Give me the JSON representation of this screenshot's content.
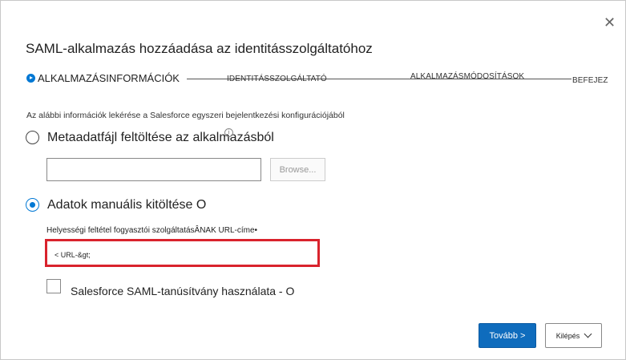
{
  "dialog": {
    "title": "SAML-alkalmazás hozzáadása az identitásszolgáltatóhoz",
    "close_glyph": "✕"
  },
  "steps": [
    {
      "label": "ALKALMAZÁSINFORMÁCIÓK",
      "active": true
    },
    {
      "label": "IDENTITÁSSZOLGÁLTATÓ",
      "active": false
    },
    {
      "label": "ALKALMAZÁSMÓDOSÍTÁSOK",
      "active": false
    },
    {
      "label": "BEFEJEZ",
      "active": false
    }
  ],
  "info_text": "Az alábbi információk lekérése a Salesforce egyszeri bejelentkezési konfigurációjából",
  "options": {
    "metadata": {
      "label": "Metaadatfájl feltöltése az alkalmazásból",
      "selected": false,
      "info_glyph": "i"
    },
    "manual": {
      "label": "Adatok manuális kitöltése O",
      "selected": true
    }
  },
  "file_upload": {
    "value": "",
    "browse_label": "Browse..."
  },
  "acs_field": {
    "label": "Helyességi feltétel fogyasztói szolgáltatásÂNAK URL-címe•",
    "value": "< URL-&gt;"
  },
  "certificate_checkbox": {
    "label": "Salesforce SAML-tanúsítvány használata - O",
    "checked": false
  },
  "footer": {
    "next_label": "Tovább >",
    "exit_label": "Kilépés"
  },
  "colors": {
    "accent": "#0078d4",
    "primary_button": "#0f6cbd",
    "highlight_border": "#d9232d"
  }
}
